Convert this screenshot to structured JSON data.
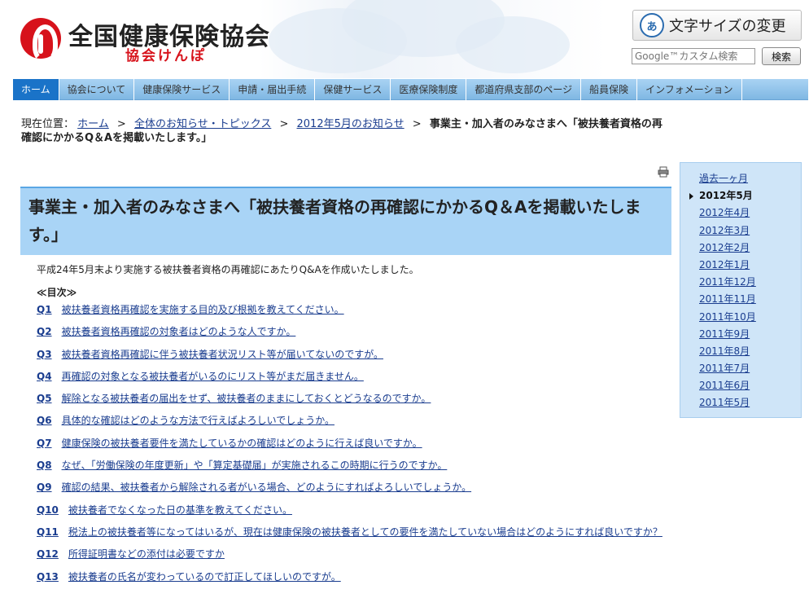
{
  "header": {
    "org_name": "全国健康保険協会",
    "org_sub": "協会けんぽ",
    "font_size_button": "文字サイズの変更",
    "font_size_icon_glyph": "あ",
    "search_placeholder": "Google™カスタム検索",
    "search_button": "検索"
  },
  "nav": {
    "items": [
      "ホーム",
      "協会について",
      "健康保険サービス",
      "申請・届出手続",
      "保健サービス",
      "医療保険制度",
      "都道府県支部のページ",
      "船員保険",
      "インフォメーション"
    ]
  },
  "breadcrumb": {
    "prefix": "現在位置：",
    "links": [
      "ホーム",
      "全体のお知らせ・トピックス",
      "2012年5月のお知らせ"
    ],
    "current": "事業主・加入者のみなさまへ「被扶養者資格の再確認にかかるQ＆Aを掲載いたします。」",
    "separator": ">"
  },
  "main": {
    "title": "事業主・加入者のみなさまへ「被扶養者資格の再確認にかかるQ＆Aを掲載いたします。」",
    "intro": "平成24年5月末より実施する被扶養者資格の再確認にあたりQ&Aを作成いたしました。",
    "toc_label": "≪目次≫",
    "qa": [
      {
        "num": "Q1",
        "text": "被扶養者資格再確認を実施する目的及び根拠を教えてください。"
      },
      {
        "num": "Q2",
        "text": "被扶養者資格再確認の対象者はどのような人ですか。"
      },
      {
        "num": "Q3",
        "text": "被扶養者資格再確認に伴う被扶養者状況リスト等が届いてないのですが。"
      },
      {
        "num": "Q4",
        "text": "再確認の対象となる被扶養者がいるのにリスト等がまだ届きません。"
      },
      {
        "num": "Q5",
        "text": "解除となる被扶養者の届出をせず、被扶養者のままにしておくとどうなるのですか。"
      },
      {
        "num": "Q6",
        "text": "具体的な確認はどのような方法で行えばよろしいでしょうか。"
      },
      {
        "num": "Q7",
        "text": "健康保険の被扶養者要件を満たしているかの確認はどのように行えば良いですか。"
      },
      {
        "num": "Q8",
        "text": "なぜ、「労働保険の年度更新」や「算定基礎届」が実施されるこの時期に行うのですか。"
      },
      {
        "num": "Q9",
        "text": "確認の結果、被扶養者から解除される者がいる場合、どのようにすればよろしいでしょうか。"
      },
      {
        "num": "Q10",
        "text": "被扶養者でなくなった日の基準を教えてください。"
      },
      {
        "num": "Q11",
        "text": "税法上の被扶養者等になってはいるが、現在は健康保険の被扶養者としての要件を満たしていない場合はどのようにすれば良いですか？"
      },
      {
        "num": "Q12",
        "text": "所得証明書などの添付は必要ですか"
      },
      {
        "num": "Q13",
        "text": "被扶養者の氏名が変わっているので訂正してほしいのですが。"
      }
    ]
  },
  "sidebar": {
    "items": [
      "過去一ヶ月",
      "2012年5月",
      "2012年4月",
      "2012年3月",
      "2012年2月",
      "2012年1月",
      "2011年12月",
      "2011年11月",
      "2011年10月",
      "2011年9月",
      "2011年8月",
      "2011年7月",
      "2011年6月",
      "2011年5月"
    ],
    "active_index": 1
  },
  "colors": {
    "brand_red": "#d7121b",
    "nav_active": "#1a73c8",
    "title_bg": "#a9d4f6",
    "link": "#1a3d8f",
    "sidebar_bg": "#cfe5f8"
  }
}
